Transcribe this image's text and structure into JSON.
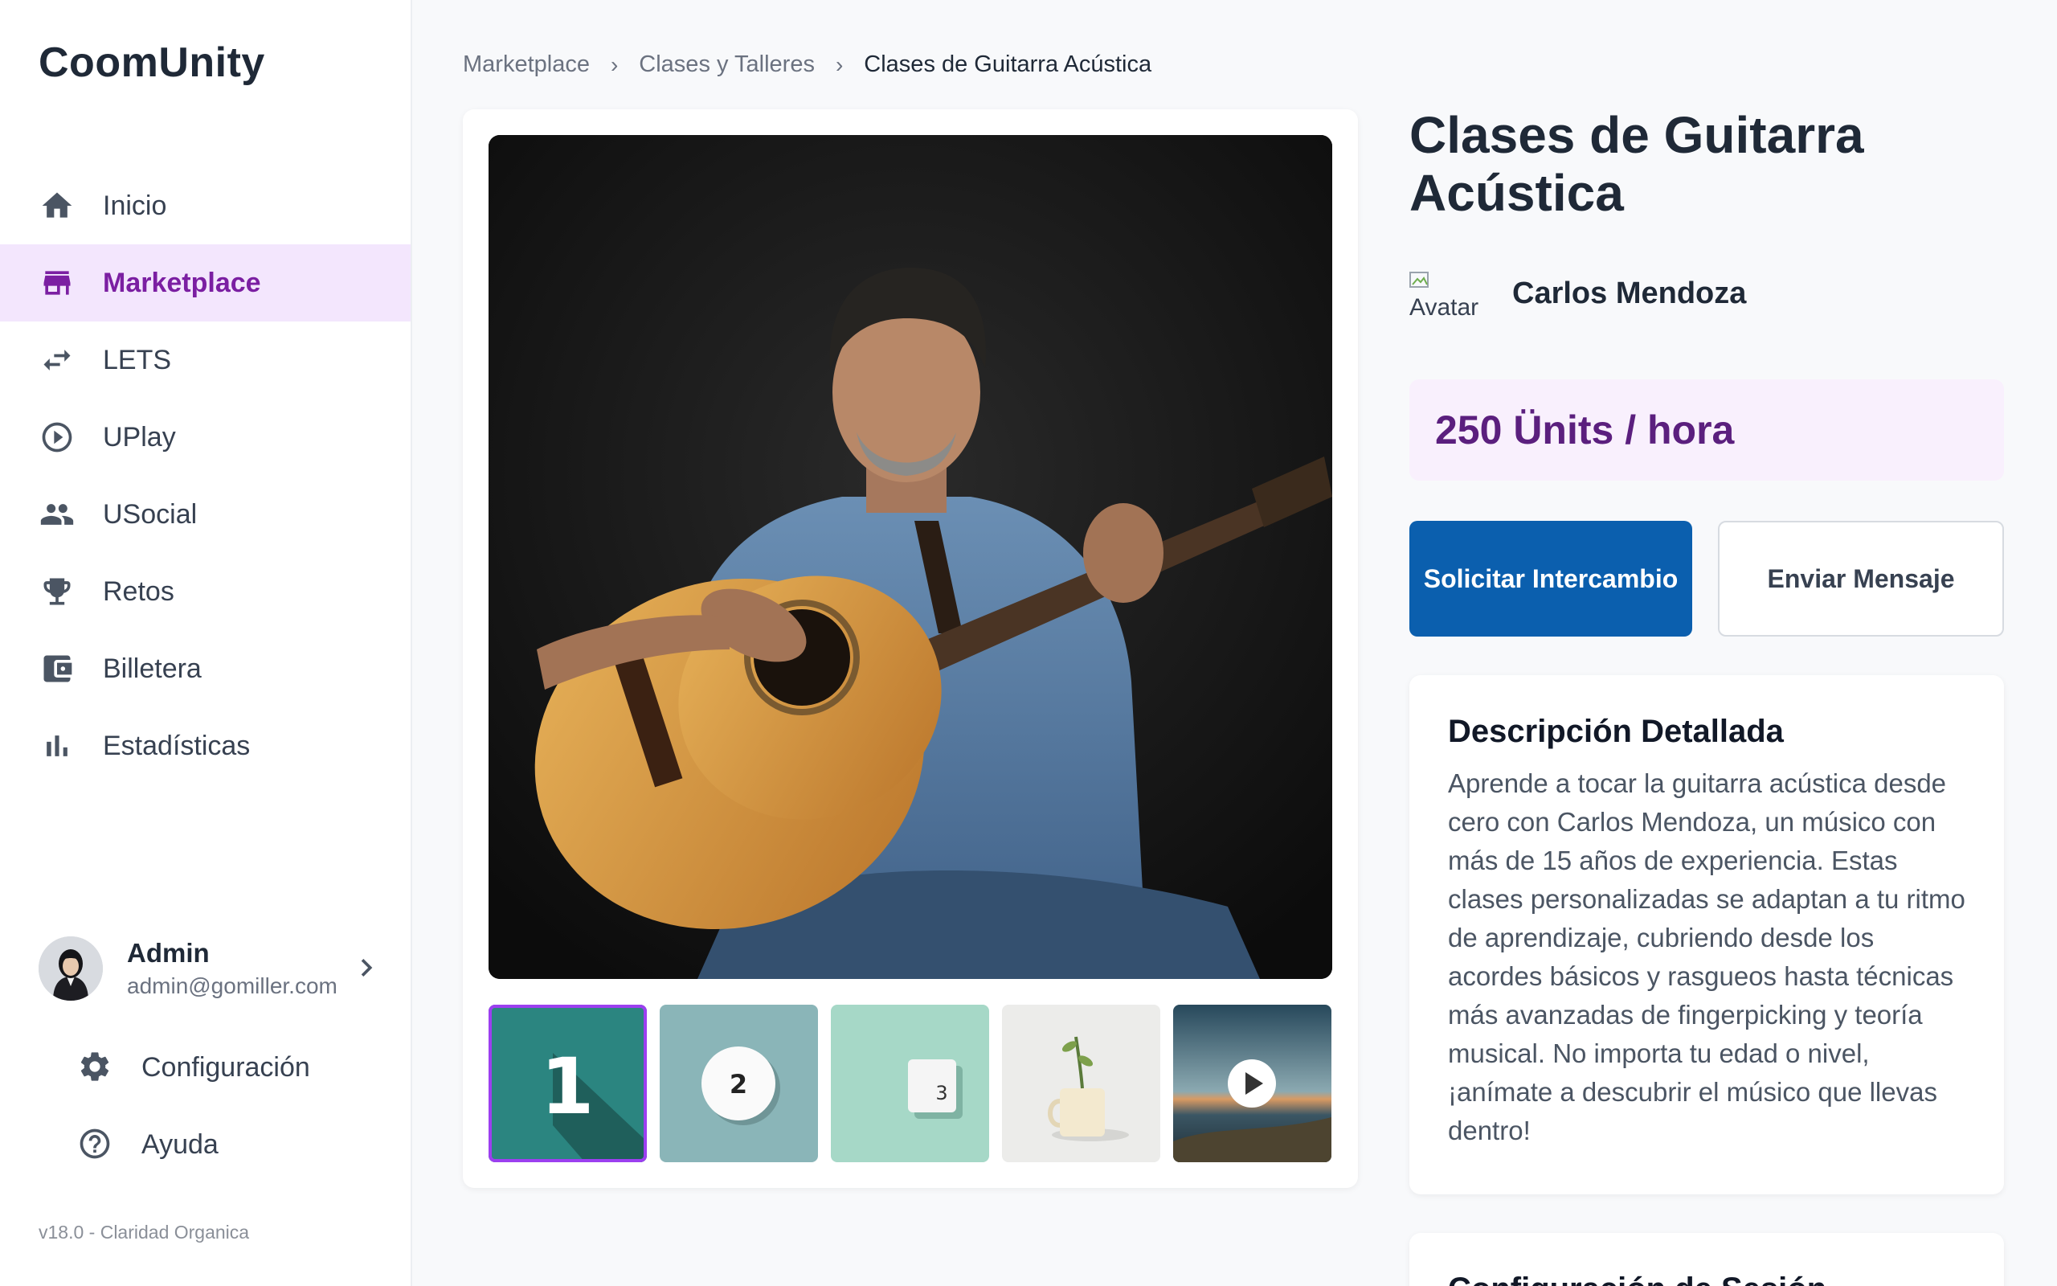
{
  "app": {
    "logo": "CoomUnity",
    "version": "v18.0 - Claridad Organica"
  },
  "sidebar": {
    "items": [
      {
        "label": "Inicio",
        "icon": "home-icon"
      },
      {
        "label": "Marketplace",
        "icon": "store-icon",
        "active": true
      },
      {
        "label": "LETS",
        "icon": "swap-icon"
      },
      {
        "label": "UPlay",
        "icon": "play-circle-icon"
      },
      {
        "label": "USocial",
        "icon": "people-icon"
      },
      {
        "label": "Retos",
        "icon": "trophy-icon"
      },
      {
        "label": "Billetera",
        "icon": "wallet-icon"
      },
      {
        "label": "Estadísticas",
        "icon": "bar-chart-icon"
      }
    ],
    "user": {
      "name": "Admin",
      "email": "admin@gomiller.com"
    },
    "footer_items": [
      {
        "label": "Configuración",
        "icon": "gear-icon"
      },
      {
        "label": "Ayuda",
        "icon": "help-icon"
      }
    ]
  },
  "breadcrumb": [
    "Marketplace",
    "Clases y Talleres",
    "Clases de Guitarra Acústica"
  ],
  "product": {
    "title": "Clases de Guitarra Acústica",
    "seller_avatar_alt": "Avatar",
    "seller_name": "Carlos Mendoza",
    "price": "250 Ünits / hora",
    "primary_button": "Solicitar Intercambio",
    "secondary_button": "Enviar Mensaje",
    "description_title": "Descripción Detallada",
    "description": "Aprende a tocar la guitarra acústica desde cero con Carlos Mendoza, un músico con más de 15 años de experiencia. Estas clases personalizadas se adaptan a tu ritmo de aprendizaje, cubriendo desde los acordes básicos y rasgueos hasta técnicas más avanzadas de fingerpicking y teoría musical. No importa tu edad o nivel, ¡anímate a descubrir el músico que llevas dentro!",
    "next_section_title": "Configuración de Sesión"
  },
  "thumbnails": [
    {
      "label": "1",
      "active": true
    },
    {
      "label": "2"
    },
    {
      "label": "3"
    },
    {
      "label": ""
    },
    {
      "label": ""
    }
  ]
}
